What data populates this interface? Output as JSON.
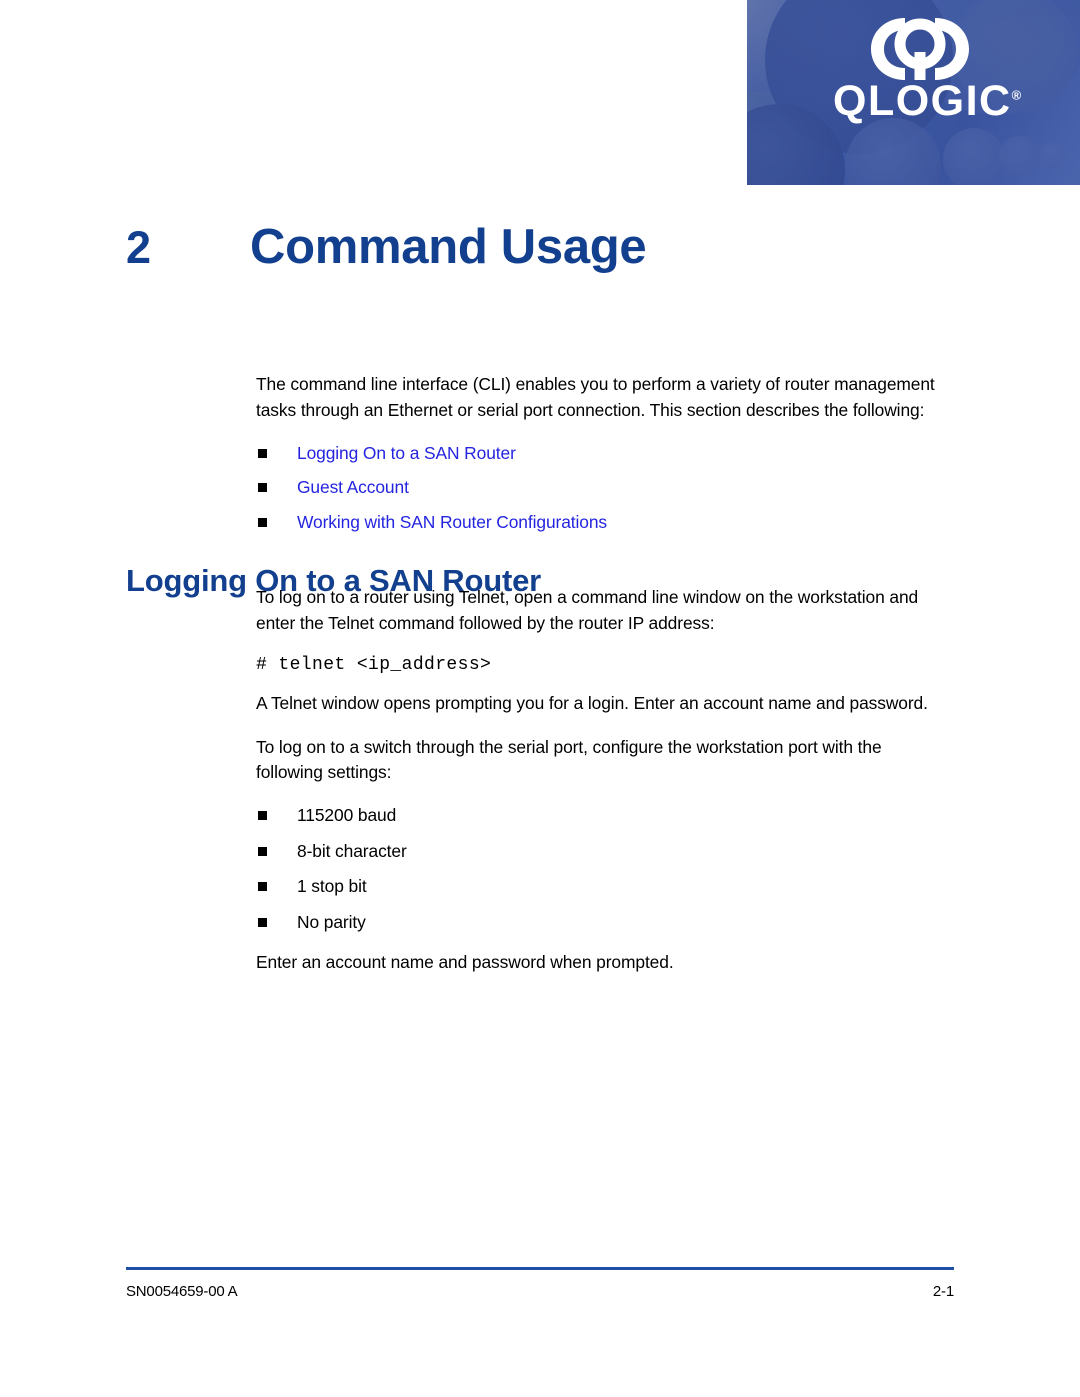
{
  "logo": {
    "mark_name": "qlogic-monogram",
    "wordmark": "QLOGIC",
    "registered_symbol": "®"
  },
  "chapter": {
    "number": "2",
    "title": "Command Usage"
  },
  "intro": {
    "paragraph": "The command line interface (CLI) enables you to perform a variety of router management tasks through an Ethernet or serial port connection. This section describes the following:"
  },
  "toc_links": [
    {
      "label": "Logging On to a SAN Router"
    },
    {
      "label": "Guest Account"
    },
    {
      "label": "Working with SAN Router Configurations"
    }
  ],
  "section": {
    "heading": "Logging On to a SAN Router",
    "paragraph_1": "To log on to a router using Telnet, open a command line window on the workstation and enter the Telnet command followed by the router IP address:",
    "command": "# telnet <ip_address>",
    "paragraph_2": "A Telnet window opens prompting you for a login. Enter an account name and password.",
    "paragraph_3": "To log on to a switch through the serial port, configure the workstation port with the following settings:",
    "paragraph_4": "Enter an account name and password when prompted."
  },
  "serial_settings": [
    {
      "label": "115200 baud"
    },
    {
      "label": "8-bit character"
    },
    {
      "label": "1 stop bit"
    },
    {
      "label": "No parity"
    }
  ],
  "footer": {
    "doc_id": "SN0054659-00 A",
    "page_number": "2-1"
  },
  "colors": {
    "heading_navy": "#123f8e",
    "link_blue": "#2424e0",
    "rule_blue": "#1f4fa8",
    "banner_blue": "#3f5da6"
  }
}
